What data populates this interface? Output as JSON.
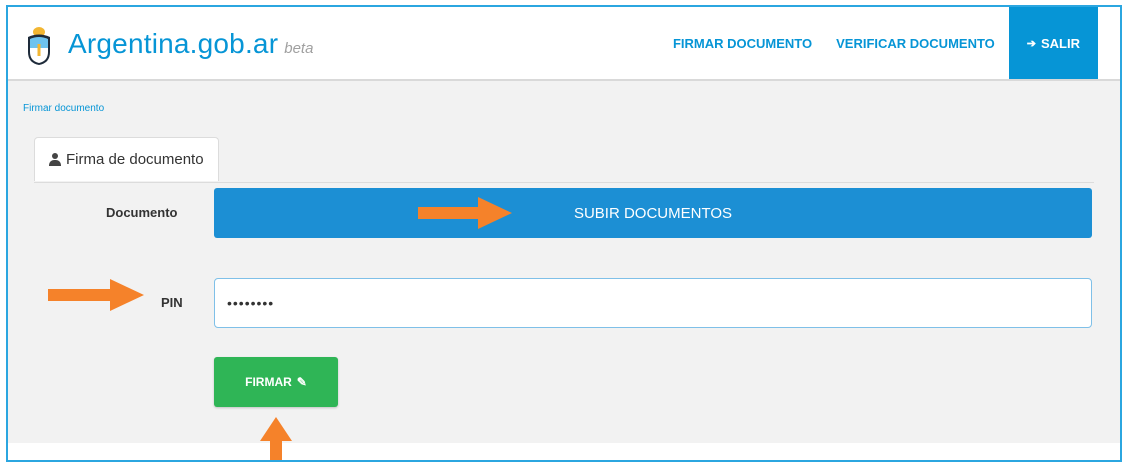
{
  "header": {
    "brand_name": "Argentina.gob.ar",
    "brand_suffix": "beta",
    "nav": {
      "sign_label": "FIRMAR DOCUMENTO",
      "verify_label": "VERIFICAR DOCUMENTO",
      "logout_label": "SALIR"
    }
  },
  "breadcrumb": "Firmar documento",
  "tab": {
    "label": "Firma de documento"
  },
  "form": {
    "document_label": "Documento",
    "upload_label": "SUBIR DOCUMENTOS",
    "pin_label": "PIN",
    "pin_value": "••••••••",
    "submit_label": "FIRMAR"
  },
  "colors": {
    "brand": "#0695d6",
    "upload_button": "#1c8fd4",
    "submit_button": "#2fb556",
    "annotation_arrow": "#f5822a"
  },
  "icons": [
    "argentina-shield-icon",
    "logout-icon",
    "user-icon",
    "pencil-icon",
    "orange-arrow-icon"
  ]
}
